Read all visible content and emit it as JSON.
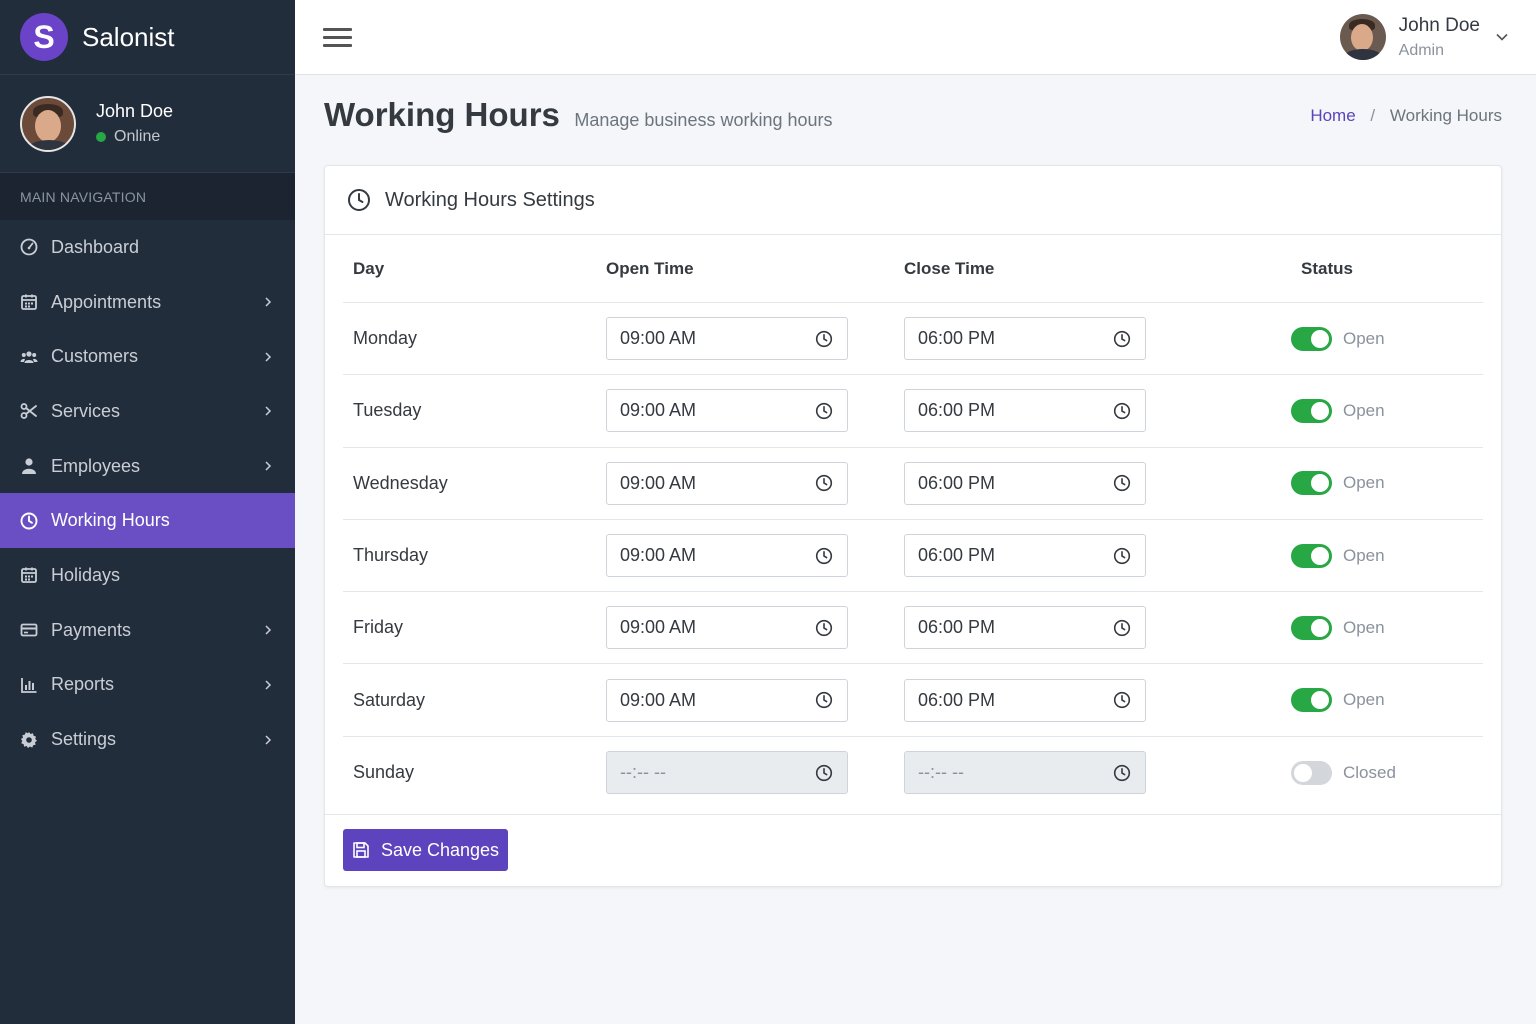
{
  "brand": {
    "logo_letter": "S",
    "name": "Salonist"
  },
  "sidebar_user": {
    "name": "John Doe",
    "status": "Online"
  },
  "nav": {
    "header": "MAIN NAVIGATION",
    "items": [
      {
        "label": "Dashboard",
        "icon": "dashboard-icon",
        "has_submenu": false,
        "active": false
      },
      {
        "label": "Appointments",
        "icon": "calendar-icon",
        "has_submenu": true,
        "active": false
      },
      {
        "label": "Customers",
        "icon": "users-icon",
        "has_submenu": true,
        "active": false
      },
      {
        "label": "Services",
        "icon": "scissors-icon",
        "has_submenu": true,
        "active": false
      },
      {
        "label": "Employees",
        "icon": "user-icon",
        "has_submenu": true,
        "active": false
      },
      {
        "label": "Working Hours",
        "icon": "clock-icon",
        "has_submenu": false,
        "active": true
      },
      {
        "label": "Holidays",
        "icon": "calendar-icon",
        "has_submenu": false,
        "active": false
      },
      {
        "label": "Payments",
        "icon": "credit-card-icon",
        "has_submenu": true,
        "active": false
      },
      {
        "label": "Reports",
        "icon": "bar-chart-icon",
        "has_submenu": true,
        "active": false
      },
      {
        "label": "Settings",
        "icon": "gear-icon",
        "has_submenu": true,
        "active": false
      }
    ]
  },
  "topbar": {
    "user_name": "John Doe",
    "user_role": "Admin"
  },
  "page": {
    "title": "Working Hours",
    "subtitle": "Manage business working hours",
    "breadcrumb": {
      "home": "Home",
      "separator": "/",
      "current": "Working Hours"
    }
  },
  "card": {
    "title": "Working Hours Settings",
    "columns": {
      "day": "Day",
      "open": "Open Time",
      "close": "Close Time",
      "status": "Status"
    },
    "rows": [
      {
        "day": "Monday",
        "open": "09:00 AM",
        "close": "06:00 PM",
        "enabled": true,
        "status": "Open"
      },
      {
        "day": "Tuesday",
        "open": "09:00 AM",
        "close": "06:00 PM",
        "enabled": true,
        "status": "Open"
      },
      {
        "day": "Wednesday",
        "open": "09:00 AM",
        "close": "06:00 PM",
        "enabled": true,
        "status": "Open"
      },
      {
        "day": "Thursday",
        "open": "09:00 AM",
        "close": "06:00 PM",
        "enabled": true,
        "status": "Open"
      },
      {
        "day": "Friday",
        "open": "09:00 AM",
        "close": "06:00 PM",
        "enabled": true,
        "status": "Open"
      },
      {
        "day": "Saturday",
        "open": "09:00 AM",
        "close": "06:00 PM",
        "enabled": true,
        "status": "Open"
      },
      {
        "day": "Sunday",
        "open": "--:-- --",
        "close": "--:-- --",
        "enabled": false,
        "status": "Closed"
      }
    ],
    "save_label": "Save Changes"
  },
  "colors": {
    "accent": "#6a4fc4",
    "sidebar_bg": "#222d3c",
    "toggle_on": "#28a745",
    "button": "#5d43bd"
  }
}
